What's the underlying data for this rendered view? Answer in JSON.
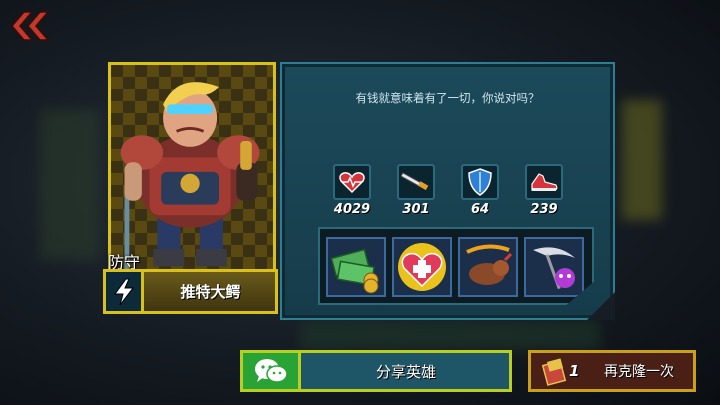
{
  "hero": {
    "role": "防守",
    "name": "推特大鳄",
    "quote": "有钱就意味着有了一切，你说对吗？",
    "card_color": "#d9c118"
  },
  "stats": [
    {
      "icon": "heart-health-icon",
      "value": "4029"
    },
    {
      "icon": "sword-attack-icon",
      "value": "301"
    },
    {
      "icon": "shield-defense-icon",
      "value": "64"
    },
    {
      "icon": "sneaker-speed-icon",
      "value": "239"
    }
  ],
  "skills": [
    {
      "icon": "money-stack-skill-icon"
    },
    {
      "icon": "heart-heal-skill-icon"
    },
    {
      "icon": "beast-charge-skill-icon"
    },
    {
      "icon": "scythe-minion-skill-icon"
    }
  ],
  "buttons": {
    "share_label": "分享英雄",
    "clone_count": "1",
    "clone_label": "再克隆一次"
  },
  "colors": {
    "accent_yellow": "#d9c118",
    "panel_teal": "#1c4a5a",
    "share_green": "#2aa336",
    "back_red": "#c0392b"
  }
}
